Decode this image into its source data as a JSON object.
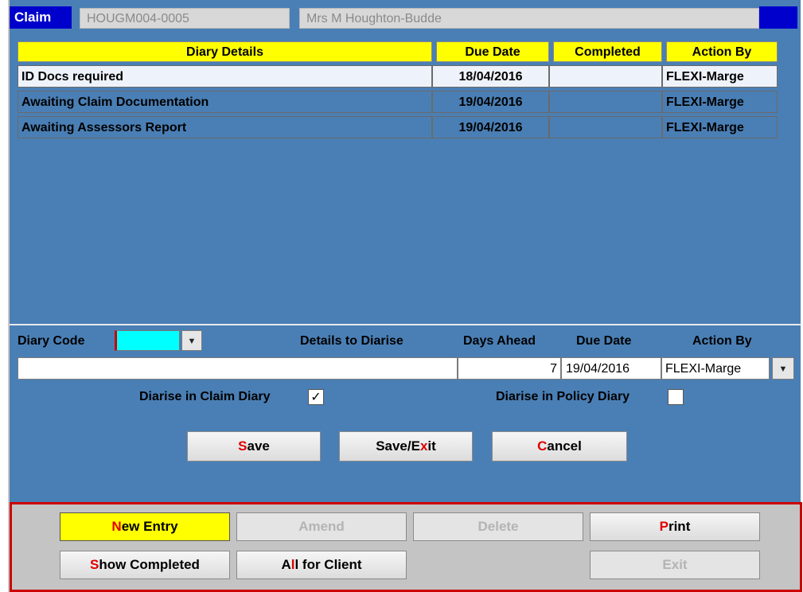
{
  "header": {
    "claim_label": "Claim",
    "claim_number": "HOUGM004-0005",
    "client_name": "Mrs M Houghton-Budde"
  },
  "table": {
    "columns": [
      "Diary Details",
      "Due Date",
      "Completed",
      "Action By"
    ],
    "rows": [
      {
        "details": "ID Docs required",
        "due_date": "18/04/2016",
        "completed": "",
        "action_by": "FLEXI-Marge"
      },
      {
        "details": "Awaiting Claim Documentation",
        "due_date": "19/04/2016",
        "completed": "",
        "action_by": "FLEXI-Marge"
      },
      {
        "details": "Awaiting Assessors Report",
        "due_date": "19/04/2016",
        "completed": "",
        "action_by": "FLEXI-Marge"
      }
    ]
  },
  "entry": {
    "diary_code_label": "Diary Code",
    "details_label": "Details to Diarise",
    "days_ahead_label": "Days Ahead",
    "due_date_label": "Due Date",
    "action_by_label": "Action By",
    "details_value": "",
    "days_ahead_value": "7",
    "due_date_value": "19/04/2016",
    "action_by_value": "FLEXI-Marge",
    "claim_diary_label": "Diarise in Claim Diary",
    "claim_diary_checked": true,
    "policy_diary_label": "Diarise in Policy Diary",
    "policy_diary_checked": false,
    "check_mark": "✓",
    "dropdown_arrow": "▼"
  },
  "form_buttons": {
    "save": {
      "hotkey": "S",
      "rest": "ave"
    },
    "save_exit": {
      "pre": "Save/E",
      "hotkey": "x",
      "rest": "it"
    },
    "cancel": {
      "hotkey": "C",
      "rest": "ancel"
    }
  },
  "bottom_buttons": {
    "new_entry": {
      "hotkey": "N",
      "rest": "ew Entry"
    },
    "amend": "Amend",
    "delete": "Delete",
    "print": {
      "hotkey": "P",
      "rest": "rint"
    },
    "show_completed": {
      "hotkey": "S",
      "rest": "how Completed"
    },
    "all_for_client": {
      "pre": "A",
      "hotkey": "l",
      "rest": "l for Client"
    },
    "exit": "Exit"
  },
  "colors": {
    "panel_blue": "#4a7fb5",
    "header_yellow": "#ffff00",
    "title_blue": "#0000cc",
    "hotkey_red": "#e00000",
    "frame_red": "#cc0000",
    "diary_code_cyan": "#00ffff"
  }
}
